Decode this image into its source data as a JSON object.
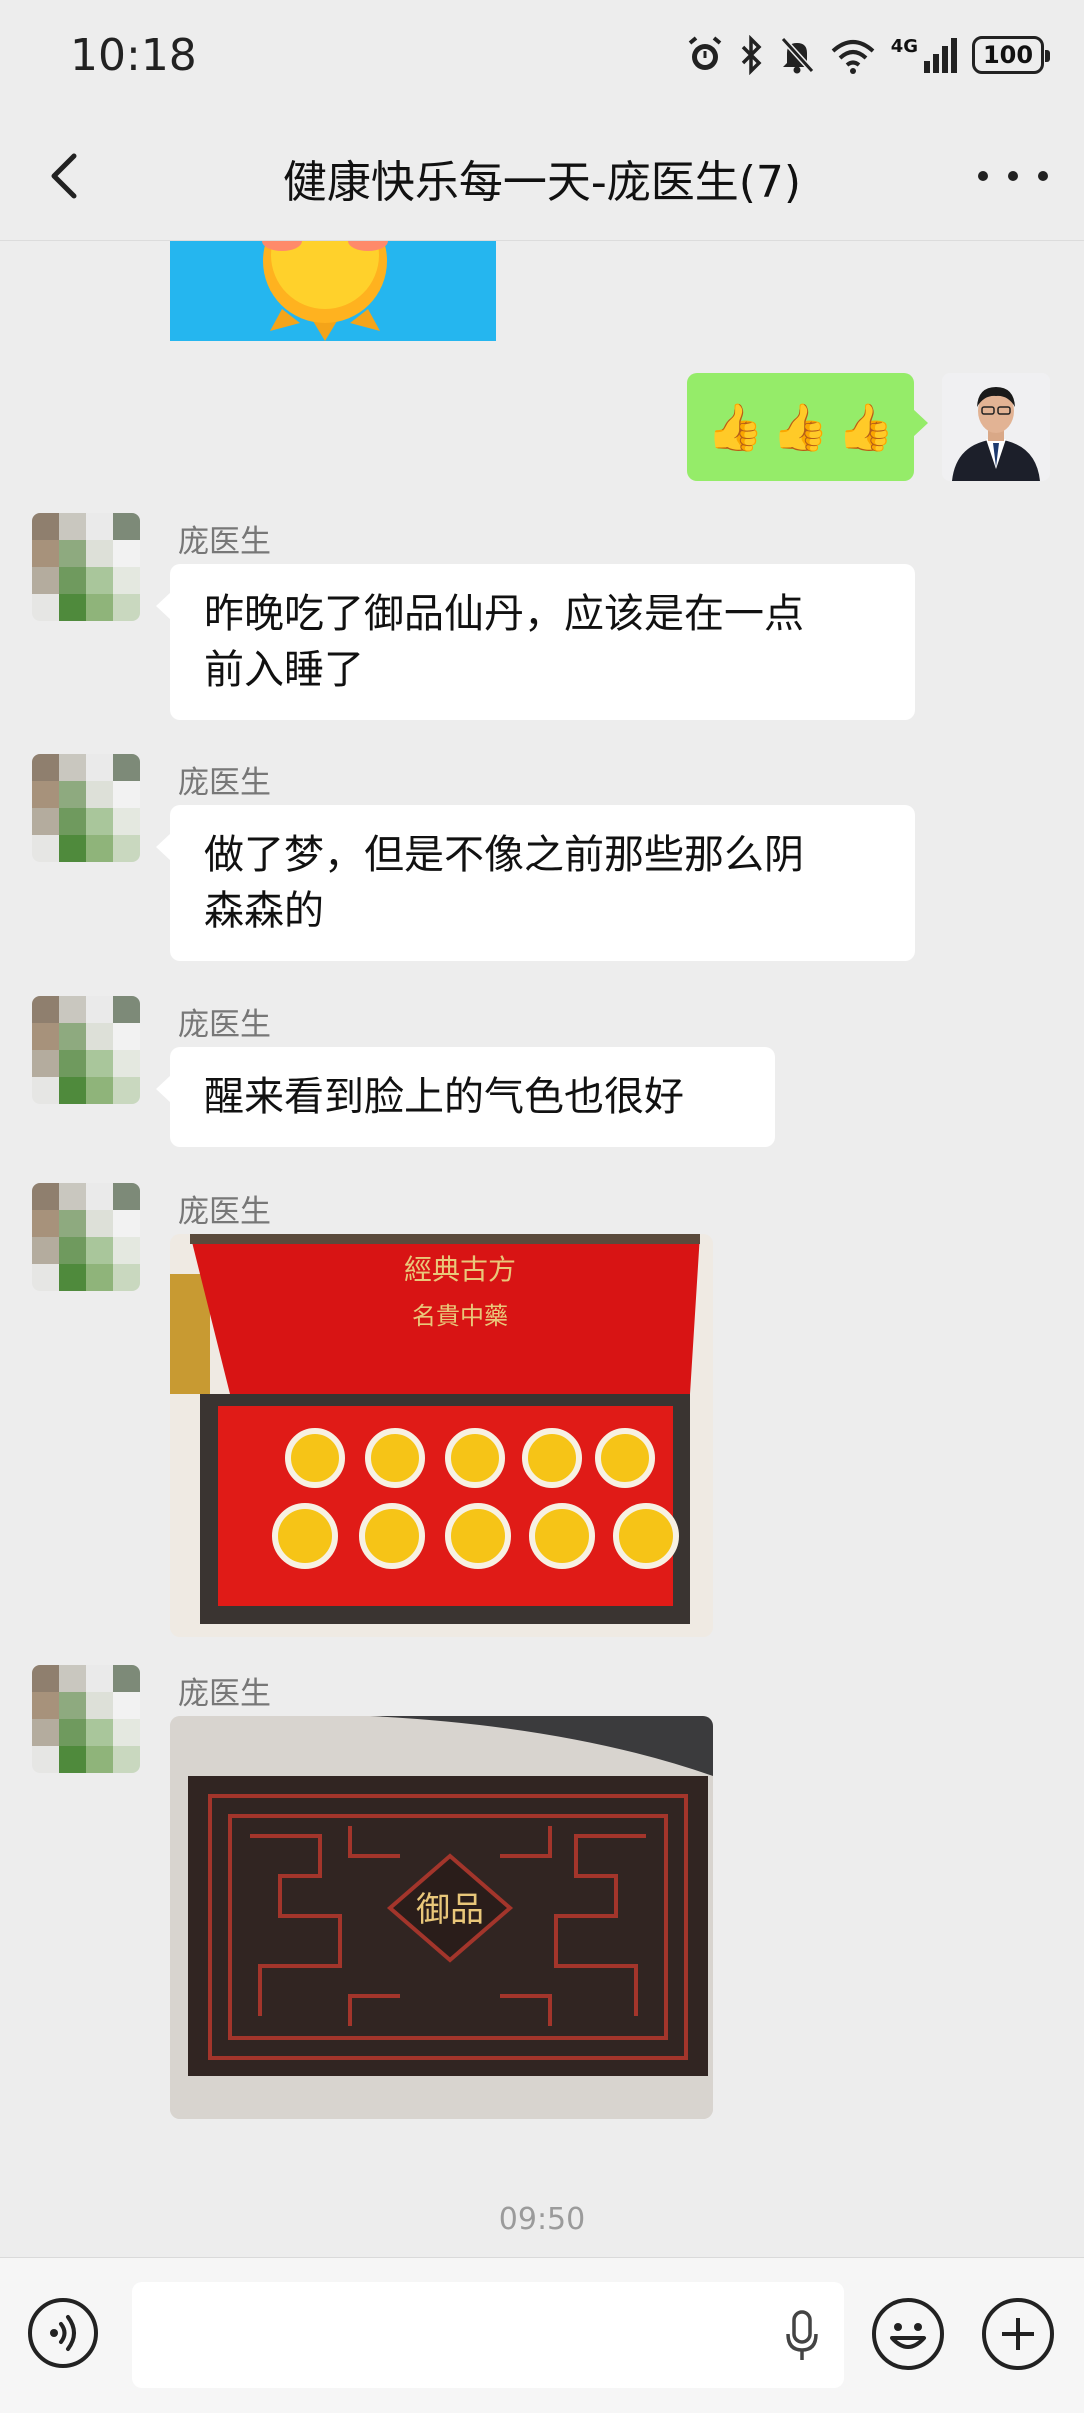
{
  "status_bar": {
    "time": "10:18",
    "battery": "100",
    "network": "4G",
    "icons": [
      "alarm-icon",
      "bluetooth-icon",
      "mute-icon",
      "wifi-icon",
      "signal-icon",
      "battery-icon"
    ]
  },
  "header": {
    "title": "健康快乐每一天-庞医生(7)",
    "back_icon": "chevron-left-icon",
    "more_icon": "more-dots-icon"
  },
  "messages": [
    {
      "type": "image",
      "from": "other",
      "description_icon": "sun-sticker"
    },
    {
      "type": "emoji",
      "from": "me",
      "content": [
        "👍",
        "👍",
        "👍"
      ]
    },
    {
      "type": "text",
      "from": "other",
      "sender": "庞医生",
      "lines": [
        "昨晚吃了御品仙丹，应该是在一点",
        "前入睡了"
      ]
    },
    {
      "type": "text",
      "from": "other",
      "sender": "庞医生",
      "lines": [
        "做了梦，但是不像之前那些那么阴",
        "森森的"
      ]
    },
    {
      "type": "text",
      "from": "other",
      "sender": "庞医生",
      "lines": [
        "醒来看到脸上的气色也很好"
      ]
    },
    {
      "type": "image",
      "from": "other",
      "sender": "庞医生",
      "photo_text": [
        "經典古方",
        "名貴中藥"
      ]
    },
    {
      "type": "image",
      "from": "other",
      "sender": "庞医生",
      "photo_text": [
        "御品"
      ]
    }
  ],
  "timestamp": "09:50",
  "input_bar": {
    "voice_icon": "voice-toggle-icon",
    "mic_icon": "microphone-icon",
    "emoji_icon": "emoji-icon",
    "plus_icon": "plus-icon"
  },
  "colors": {
    "background": "#ededed",
    "my_bubble": "#95ec69",
    "their_bubble": "#ffffff",
    "box_red": "#d81414"
  }
}
